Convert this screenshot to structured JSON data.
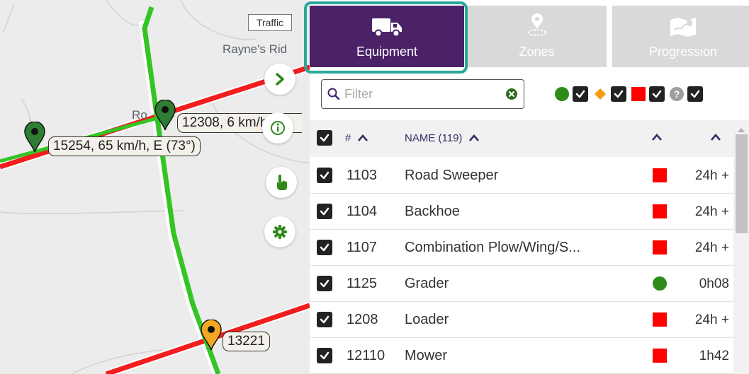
{
  "map": {
    "traffic_label": "Traffic",
    "place_labels": [
      "Rayne's Rid",
      "Ro"
    ],
    "pins": [
      {
        "label": "15254, 65 km/h, E (73°)",
        "color": "#2e7d32"
      },
      {
        "label": "12308, 6 km/h,",
        "color": "#2e7d32"
      },
      {
        "label": "13221",
        "color": "#f5a623"
      }
    ],
    "controls": {
      "expand_icon": "chevron-right-icon",
      "info_icon": "info-icon",
      "touch_icon": "hand-pointer-icon",
      "settings_icon": "gear-icon"
    },
    "colors": {
      "green_route": "#34c524",
      "red_route": "#f21d1d",
      "road": "#ffffff"
    }
  },
  "panel": {
    "tabs": [
      {
        "label": "Equipment",
        "icon": "truck-icon",
        "active": true
      },
      {
        "label": "Zones",
        "icon": "map-pin-icon",
        "active": false
      },
      {
        "label": "Progression",
        "icon": "map-route-icon",
        "active": false
      }
    ],
    "filter": {
      "placeholder": "Filter",
      "value": ""
    },
    "legend": [
      {
        "shape": "circle",
        "color": "#2e8b1a",
        "checked": true
      },
      {
        "shape": "diamond",
        "color": "#f39c12",
        "checked": true
      },
      {
        "shape": "square",
        "color": "#ff0000",
        "checked": true
      },
      {
        "shape": "question",
        "color": "#9e9e9e",
        "checked": true
      }
    ],
    "table": {
      "col_num": "#",
      "col_name": "NAME (119)",
      "rows": [
        {
          "num": "1103",
          "name": "Road Sweeper",
          "status": "square",
          "status_color": "#ff0000",
          "duration": "24h +"
        },
        {
          "num": "1104",
          "name": "Backhoe",
          "status": "square",
          "status_color": "#ff0000",
          "duration": "24h +"
        },
        {
          "num": "1107",
          "name": "Combination Plow/Wing/S...",
          "status": "square",
          "status_color": "#ff0000",
          "duration": "24h +"
        },
        {
          "num": "1125",
          "name": "Grader",
          "status": "circle",
          "status_color": "#2e8b1a",
          "duration": "0h08"
        },
        {
          "num": "1208",
          "name": "Loader",
          "status": "square",
          "status_color": "#ff0000",
          "duration": "24h +"
        },
        {
          "num": "12110",
          "name": "Mower",
          "status": "square",
          "status_color": "#ff0000",
          "duration": "1h42"
        }
      ]
    },
    "colors": {
      "active_tab": "#4b2268",
      "highlight": "#2aa89a",
      "inactive_tab": "#d9d9d9"
    }
  }
}
